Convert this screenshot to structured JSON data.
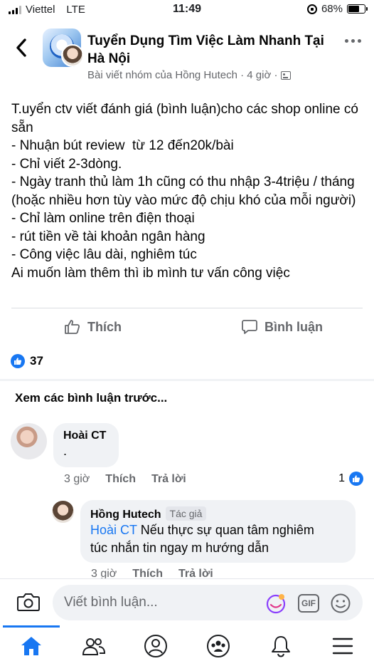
{
  "status_bar": {
    "carrier": "Viettel",
    "network": "LTE",
    "time": "11:49",
    "battery_text": "68%",
    "battery_level": 0.68
  },
  "post": {
    "group_name": "Tuyển Dụng Tìm Việc Làm Nhanh Tại Hà Nội",
    "meta_text": "Bài viết nhóm của Hồng Hutech · 4 giờ ·",
    "body_lines": [
      "T.uyển ctv viết đánh giá (bình luận)cho các shop online có sẵn",
      "- Nhuận bút review  từ 12 đến20k/bài",
      "- Chỉ viết 2-3dòng.",
      "- Ngày tranh thủ làm 1h cũng có thu nhập 3-4triệu / tháng (hoặc nhiều hơn tùy vào mức độ chịu khó của mỗi người)",
      "- Chỉ làm online trên điện thoại",
      "- rút tiền về tài khoản ngân hàng",
      "- Công việc lâu dài, nghiêm túc",
      "Ai muốn làm thêm thì ib mình tư vấn công việc"
    ],
    "actions": {
      "like_label": "Thích",
      "comment_label": "Bình luận"
    },
    "reaction_count": "37"
  },
  "comments": {
    "previous_label": "Xem các bình luận trước...",
    "items": [
      {
        "name": "Hoài CT",
        "text": ".",
        "time": "3 giờ",
        "like_label": "Thích",
        "reply_label": "Trả lời",
        "like_count": "1"
      }
    ],
    "reply": {
      "name": "Hồng Hutech",
      "badge": "Tác giả",
      "mention": "Hoài CT",
      "text_line1": " Nếu thực sự quan tâm nghiêm",
      "text_line2": "túc nhắn tin ngay m hướng dẫn",
      "time": "3 giờ",
      "like_label": "Thích",
      "reply_label": "Trả lời"
    }
  },
  "composer": {
    "placeholder": "Viết bình luận...",
    "gif_label": "GIF"
  },
  "bottom_nav": {
    "items": [
      "home-icon",
      "friends-icon",
      "profile-icon",
      "groups-icon",
      "notifications-icon",
      "menu-icon"
    ],
    "active": "home-icon",
    "active_color": "#1877f2"
  },
  "colors": {
    "accent": "#1877f2",
    "secondary_text": "#65676b",
    "bubble": "#f0f2f5"
  }
}
